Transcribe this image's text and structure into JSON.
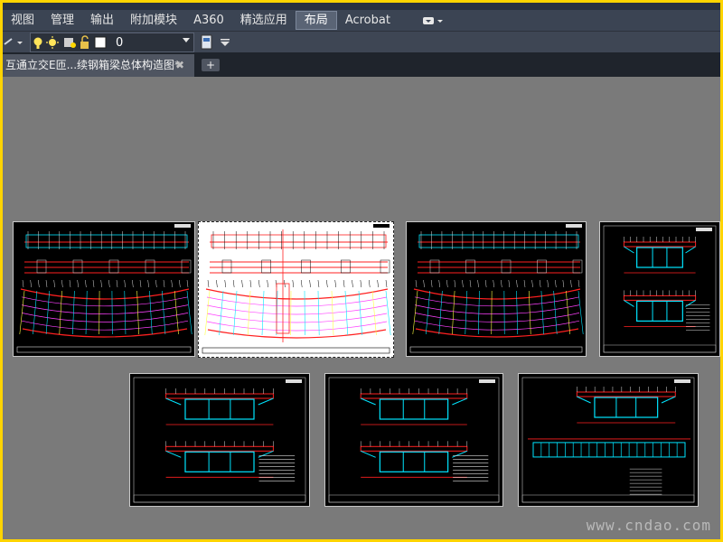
{
  "window": {
    "menubar_visible": true
  },
  "ribbon": {
    "tabs": [
      {
        "label": "视图"
      },
      {
        "label": "管理"
      },
      {
        "label": "输出"
      },
      {
        "label": "附加模块"
      },
      {
        "label": "A360"
      },
      {
        "label": "精选应用"
      },
      {
        "label": "布局",
        "active": true
      },
      {
        "label": "Acrobat"
      }
    ]
  },
  "toolbar": {
    "layer_value": "0"
  },
  "document_tab": {
    "title": "互通立交E匝...续钢箱梁总体构造图*",
    "close_glyph": "✖",
    "new_tab_glyph": "+"
  },
  "watermark": {
    "text": "www.cndao.com"
  },
  "colors": {
    "frame_border": "#ffd400",
    "canvas": "#7a7a7a",
    "sheet_dark": "#000000",
    "sheet_light": "#ffffff",
    "line_red": "#ff2020",
    "line_cyan": "#00e5ff",
    "line_magenta": "#ff40ff",
    "line_yellow": "#ffff40"
  },
  "layouts": [
    {
      "name": "layout-plan-1",
      "style": "dark",
      "kind": "plan"
    },
    {
      "name": "layout-plan-2",
      "style": "light",
      "kind": "plan",
      "selected": true
    },
    {
      "name": "layout-plan-3",
      "style": "dark",
      "kind": "plan"
    },
    {
      "name": "layout-section-1",
      "style": "dark",
      "kind": "section"
    },
    {
      "name": "layout-section-2",
      "style": "dark",
      "kind": "section"
    },
    {
      "name": "layout-section-3",
      "style": "dark",
      "kind": "section"
    },
    {
      "name": "layout-section-4",
      "style": "dark",
      "kind": "section-elevation"
    }
  ]
}
